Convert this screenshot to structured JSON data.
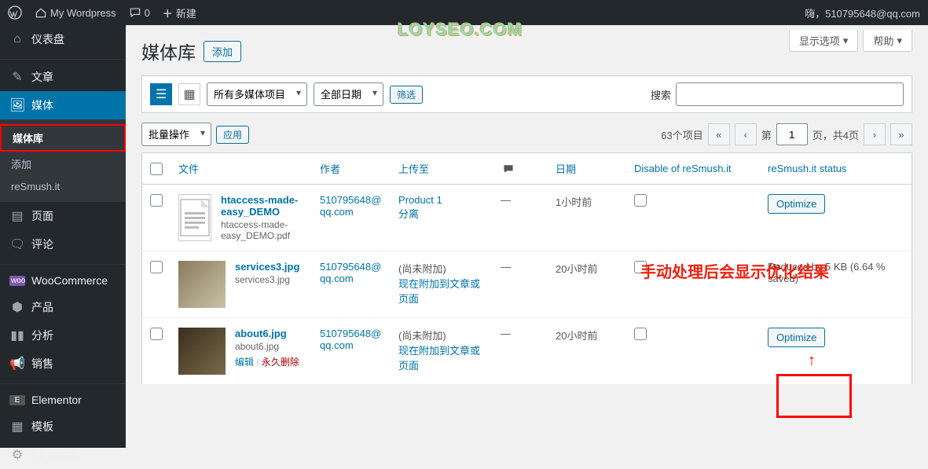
{
  "topbar": {
    "site_name": "My Wordpress",
    "comments": "0",
    "new_label": "新建",
    "account_label": "嗨，510795648@qq.com"
  },
  "watermark": "LOYSEO.COM",
  "sidebar": {
    "dashboard": "仪表盘",
    "posts": "文章",
    "media": "媒体",
    "media_sub": {
      "library": "媒体库",
      "add": "添加",
      "resmush": "reSmush.it"
    },
    "pages": "页面",
    "comments": "评论",
    "woocommerce": "WooCommerce",
    "products": "产品",
    "analytics": "分析",
    "sales": "销售",
    "elementor": "Elementor",
    "templates": "模板",
    "elements": "Elements"
  },
  "screen_opts": {
    "options": "显示选项",
    "help": "帮助"
  },
  "header": {
    "title": "媒体库",
    "add_button": "添加"
  },
  "toolbar": {
    "filter_all": "所有多媒体项目",
    "filter_date": "全部日期",
    "filter_btn": "筛选",
    "search_label": "搜索"
  },
  "bulk": {
    "action": "批量操作",
    "apply": "应用"
  },
  "pagination": {
    "count": "63个项目",
    "page_prefix": "第",
    "page_val": "1",
    "page_suffix": "页，共4页"
  },
  "columns": {
    "file": "文件",
    "author": "作者",
    "uploaded_to": "上传至",
    "date": "日期",
    "disable": "Disable of reSmush.it",
    "status": "reSmush.it status"
  },
  "rows": [
    {
      "title": "htaccess-made-easy_DEMO",
      "filename": "htaccess-made-easy_DEMO.pdf",
      "author": "510795648@qq.com",
      "upload": "Product 1\n分离",
      "comments": "—",
      "date": "1小时前",
      "status_btn": "Optimize",
      "status_text": "",
      "thumb_type": "doc"
    },
    {
      "title": "services3.jpg",
      "filename": "services3.jpg",
      "author": "510795648@qq.com",
      "upload": "(尚未附加)\n现在附加到文章或页面",
      "comments": "—",
      "date": "20小时前",
      "status_btn": "",
      "status_text": "Reduced by 5 KB (6.64 % saved)",
      "thumb_type": "img1"
    },
    {
      "title": "about6.jpg",
      "filename": "about6.jpg",
      "author": "510795648@qq.com",
      "upload": "(尚未附加)\n现在附加到文章或页面",
      "comments": "—",
      "date": "20小时前",
      "status_btn": "Optimize",
      "status_text": "",
      "thumb_type": "img2",
      "row_actions": {
        "edit": "编辑",
        "delete": "永久删除"
      }
    }
  ],
  "annotation": "手动处理后会显示优化结果"
}
